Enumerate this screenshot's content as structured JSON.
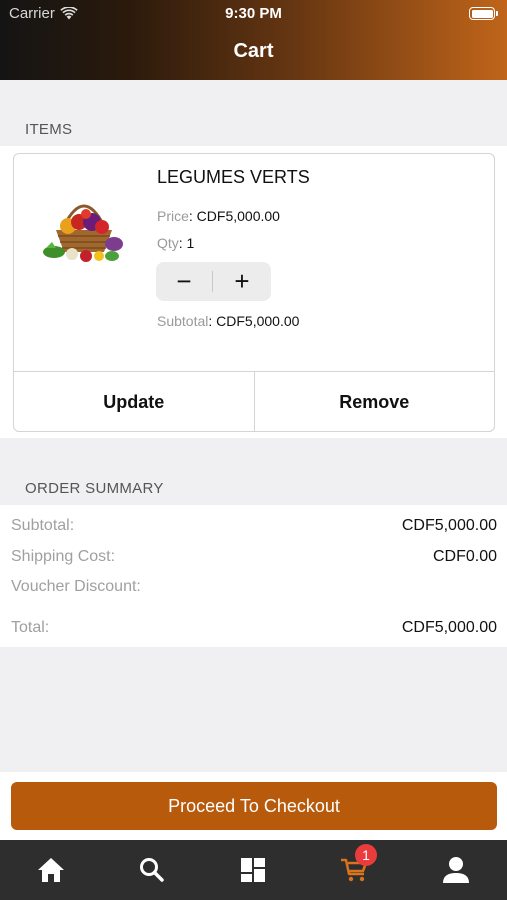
{
  "status_bar": {
    "carrier": "Carrier",
    "time": "9:30 PM"
  },
  "header": {
    "title": "Cart"
  },
  "items_section": {
    "label": "ITEMS"
  },
  "cart_item": {
    "name": "LEGUMES VERTS",
    "price_label": "Price",
    "price_value": ": CDF5,000.00",
    "qty_label": "Qty",
    "qty_value": ": 1",
    "decrement_symbol": "−",
    "increment_symbol": "+",
    "subtotal_label": "Subtotal",
    "subtotal_value": ": CDF5,000.00",
    "update_label": "Update",
    "remove_label": "Remove"
  },
  "order_summary": {
    "label": "ORDER SUMMARY",
    "subtotal_label": "Subtotal:",
    "subtotal_value": "CDF5,000.00",
    "shipping_label": "Shipping Cost:",
    "shipping_value": "CDF0.00",
    "voucher_label": "Voucher Discount:",
    "voucher_value": "",
    "total_label": "Total:",
    "total_value": "CDF5,000.00"
  },
  "checkout": {
    "label": "Proceed To Checkout"
  },
  "tab_bar": {
    "tabs": [
      {
        "icon": "home-icon"
      },
      {
        "icon": "search-icon"
      },
      {
        "icon": "categories-icon"
      },
      {
        "icon": "cart-icon",
        "badge": "1",
        "active": true
      },
      {
        "icon": "profile-icon"
      }
    ]
  },
  "colors": {
    "accent": "#b85a0c",
    "tab_active": "#d9731c",
    "tab_inactive": "#ffffff",
    "badge": "#ea3c3c",
    "tab_bar_bg": "#2e2e2e"
  }
}
